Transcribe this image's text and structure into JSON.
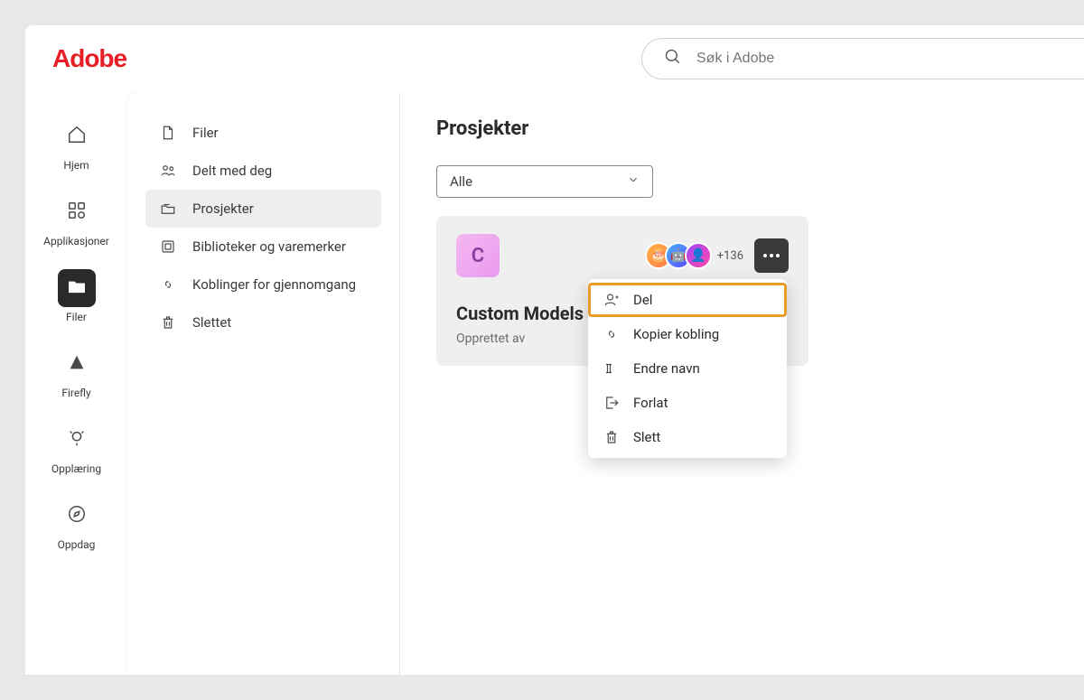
{
  "brand": "Adobe",
  "search": {
    "placeholder": "Søk i Adobe"
  },
  "rail": {
    "items": [
      {
        "key": "home",
        "label": "Hjem"
      },
      {
        "key": "apps",
        "label": "Applikasjoner"
      },
      {
        "key": "files",
        "label": "Filer"
      },
      {
        "key": "firefly",
        "label": "Firefly"
      },
      {
        "key": "learn",
        "label": "Opplæring"
      },
      {
        "key": "discover",
        "label": "Oppdag"
      }
    ]
  },
  "sidebar": {
    "items": [
      {
        "key": "files",
        "label": "Filer"
      },
      {
        "key": "shared",
        "label": "Delt med deg"
      },
      {
        "key": "projects",
        "label": "Prosjekter"
      },
      {
        "key": "libraries",
        "label": "Biblioteker og varemerker"
      },
      {
        "key": "review",
        "label": "Koblinger for gjennomgang"
      },
      {
        "key": "deleted",
        "label": "Slettet"
      }
    ]
  },
  "main": {
    "title": "Prosjekter",
    "filter_label": "Alle",
    "project": {
      "thumb_letter": "C",
      "avatar_more": "+136",
      "name": "Custom Models",
      "created_by_label": "Opprettet av"
    }
  },
  "context_menu": {
    "items": [
      {
        "key": "share",
        "label": "Del"
      },
      {
        "key": "copylink",
        "label": "Kopier kobling"
      },
      {
        "key": "rename",
        "label": "Endre navn"
      },
      {
        "key": "leave",
        "label": "Forlat"
      },
      {
        "key": "delete",
        "label": "Slett"
      }
    ]
  }
}
